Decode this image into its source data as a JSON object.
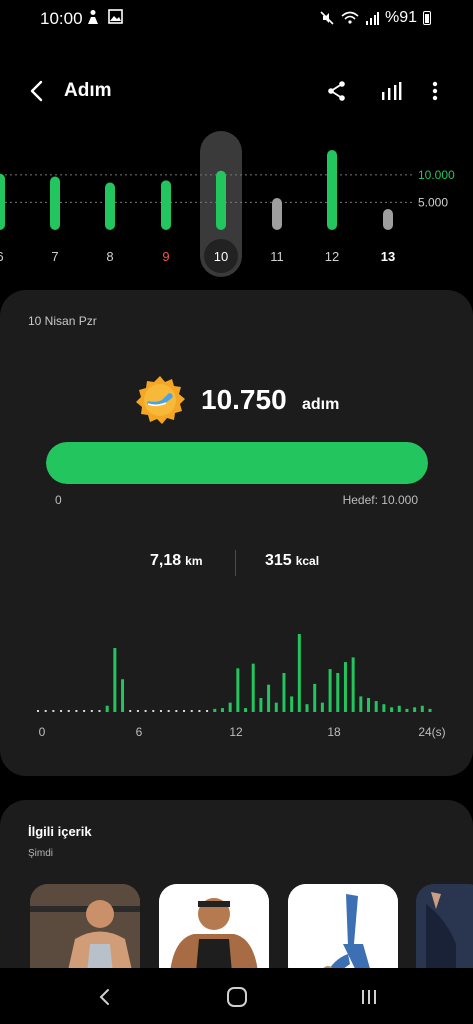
{
  "status": {
    "time": "10:00",
    "battery": "%91",
    "icons": [
      "person-icon",
      "image-icon",
      "mute-icon",
      "wifi-icon",
      "signal-icon",
      "battery-icon"
    ]
  },
  "header": {
    "title": "Adım",
    "icons": [
      "back-icon",
      "share-icon",
      "stats-icon",
      "more-icon"
    ]
  },
  "week": {
    "days": [
      "6",
      "7",
      "8",
      "9",
      "10",
      "11",
      "12",
      "13"
    ],
    "values": [
      10200,
      9700,
      8600,
      9000,
      10750,
      5800,
      14500,
      3800
    ],
    "selected": "10",
    "today": "13",
    "sunday": "9",
    "ref_labels": [
      "10.000",
      "5.000"
    ],
    "ref_values": [
      10000,
      5000
    ]
  },
  "summary": {
    "date": "10 Nisan Pzr",
    "steps": "10.750",
    "steps_unit": "adım",
    "progress": 1.0,
    "bar_min": "0",
    "goal_label": "Hedef: 10.000",
    "distance": "7,18",
    "distance_unit": "km",
    "calories": "315",
    "calories_unit": "kcal"
  },
  "hourly": {
    "x_labels": [
      "0",
      "6",
      "12",
      "18",
      "24(s)"
    ],
    "values": [
      0,
      0,
      0,
      0,
      0,
      0,
      0,
      0,
      0,
      0.08,
      0.82,
      0.42,
      0,
      0,
      0,
      0,
      0,
      0,
      0,
      0,
      0,
      0,
      0,
      0.04,
      0.05,
      0.12,
      0.56,
      0.05,
      0.62,
      0.18,
      0.35,
      0.12,
      0.5,
      0.2,
      1.0,
      0.1,
      0.36,
      0.12,
      0.55,
      0.5,
      0.64,
      0.7,
      0.2,
      0.18,
      0.14,
      0.1,
      0.06,
      0.08,
      0.04,
      0.06,
      0.08,
      0.04
    ]
  },
  "related": {
    "title": "İlgili içerik",
    "subtitle": "Şimdi"
  },
  "colors": {
    "accent": "#22c55e",
    "sunday": "#ef5350",
    "card": "#1c1c1c"
  }
}
